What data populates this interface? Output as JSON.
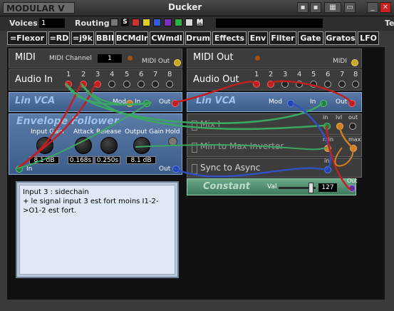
{
  "window": {
    "title": "Ducker",
    "logo": "MODULAR V",
    "buttons": [
      "save-icon",
      "save-as-icon",
      "grid-icon",
      "panel-icon",
      "minimize-icon",
      "close-icon"
    ]
  },
  "toolbar": {
    "voices_label": "Voices",
    "voices_value": "1",
    "routing_label": "Routing",
    "routing_s": "S",
    "routing_m": "M",
    "te_label": "Te",
    "routing_colors": [
      "#d03030",
      "#e0d020",
      "#3060e0",
      "#8030c0",
      "#30b040",
      "#d8d8d8"
    ]
  },
  "menu": [
    "=Flexor",
    "=RD",
    "=j9k",
    "BBII",
    "BCMdlr",
    "CWmdl",
    "Drum",
    "Effects",
    "Env",
    "Filter",
    "Gate",
    "Gratos",
    "LFO"
  ],
  "midi": {
    "title": "MIDI",
    "channel_label": "MIDI Channel",
    "channel_value": "1",
    "out_label": "MIDI Out"
  },
  "midi_out": {
    "title": "MIDI Out",
    "midi_label": "MIDI"
  },
  "audio_in": {
    "title": "Audio In",
    "ports": [
      "1",
      "2",
      "3",
      "4",
      "5",
      "6",
      "7",
      "8"
    ]
  },
  "audio_out": {
    "title": "Audio Out",
    "ports": [
      "1",
      "2",
      "3",
      "4",
      "5",
      "6",
      "7",
      "8"
    ]
  },
  "lin_vca_1": {
    "title": "Lin VCA",
    "mod": "Mod",
    "in": "In",
    "out": "Out"
  },
  "lin_vca_2": {
    "title": "Lin VCA",
    "mod": "Mod",
    "in": "In",
    "out": "Out"
  },
  "env": {
    "title": "Envelope Follower",
    "in": "In",
    "out": "Out",
    "controls": [
      {
        "label": "Input Gain",
        "value": "8.1 dB"
      },
      {
        "label": "Attack",
        "value": "0.168s"
      },
      {
        "label": "Release",
        "value": "0.250s"
      },
      {
        "label": "Output Gain",
        "value": "8.1 dB"
      }
    ],
    "hold": "Hold"
  },
  "mix": {
    "title": "Mix I",
    "in": "in",
    "lvl": "lvl",
    "out": "out"
  },
  "inverter": {
    "title": "Min to Max Inverter",
    "min": "min",
    "max": "max"
  },
  "sync": {
    "title": "Sync to Async",
    "in": "in"
  },
  "constant": {
    "title": "Constant",
    "val_label": "Val",
    "value": "127",
    "out": "Out"
  },
  "comment": {
    "text": "Input 3 : sidechain\n+ le signal input 3 est fort moins I1-2->O1-2 est fort."
  }
}
